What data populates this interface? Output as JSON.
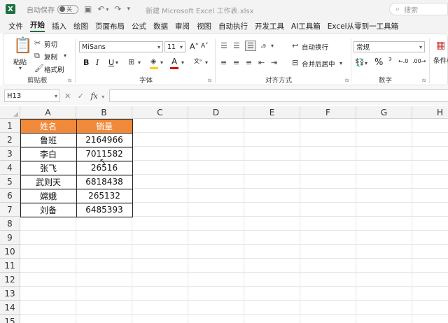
{
  "titlebar": {
    "autosave_label": "自动保存",
    "autosave_state": "关",
    "document_title": "新建 Microsoft Excel 工作表.xlsx",
    "search_placeholder": "搜索"
  },
  "menu_tabs": [
    "文件",
    "开始",
    "插入",
    "绘图",
    "页面布局",
    "公式",
    "数据",
    "审阅",
    "视图",
    "自动执行",
    "开发工具",
    "AI工具箱",
    "Excel从零到一工具箱"
  ],
  "active_tab": "开始",
  "ribbon": {
    "clipboard": {
      "paste": "粘贴",
      "cut": "剪切",
      "copy": "复制",
      "format_painter": "格式刷",
      "label": "剪贴板"
    },
    "font": {
      "font_name": "MiSans",
      "font_size": "11",
      "bold": "B",
      "italic": "I",
      "underline": "U",
      "label": "字体"
    },
    "alignment": {
      "wrap_text": "自动换行",
      "merge_center": "合并后居中",
      "label": "对齐方式"
    },
    "number": {
      "format": "常规",
      "percent": "%",
      "label": "数字"
    },
    "styles": {
      "conditional_format": "条件格"
    }
  },
  "formula_bar": {
    "name_box": "H13",
    "fx": "fx",
    "formula": ""
  },
  "sheet": {
    "columns": [
      "A",
      "B",
      "C",
      "D",
      "E",
      "F",
      "G",
      "H"
    ],
    "rows": [
      "1",
      "2",
      "3",
      "4",
      "5",
      "6",
      "7",
      "8",
      "9",
      "10",
      "11",
      "12",
      "13",
      "14",
      "15"
    ],
    "table_headers": [
      "姓名",
      "销量"
    ],
    "table_rows": [
      [
        "鲁班",
        "2164966"
      ],
      [
        "李白",
        "7011582"
      ],
      [
        "张飞",
        "26516"
      ],
      [
        "武则天",
        "6818438"
      ],
      [
        "嫦娥",
        "265132"
      ],
      [
        "刘备",
        "6485393"
      ]
    ],
    "header_color": "#f08a3a"
  }
}
